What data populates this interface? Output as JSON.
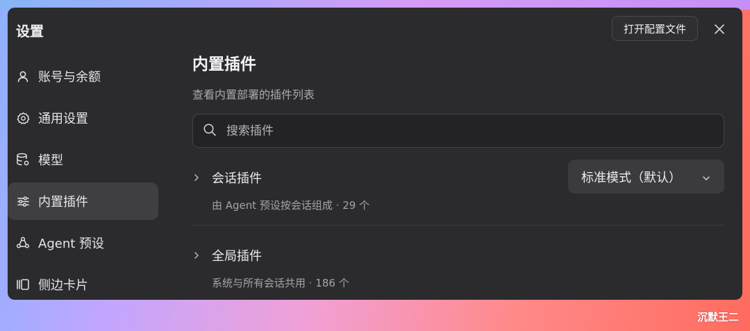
{
  "window": {
    "title": "设置",
    "open_config_label": "打开配置文件"
  },
  "sidebar": {
    "items": [
      {
        "label": "账号与余额",
        "icon": "user-icon"
      },
      {
        "label": "通用设置",
        "icon": "gear-icon"
      },
      {
        "label": "模型",
        "icon": "database-icon"
      },
      {
        "label": "内置插件",
        "icon": "sliders-icon",
        "active": true
      },
      {
        "label": "Agent 预设",
        "icon": "agent-icon"
      },
      {
        "label": "侧边卡片",
        "icon": "side-card-icon"
      }
    ]
  },
  "main": {
    "title": "内置插件",
    "subtitle": "查看内置部署的插件列表",
    "search": {
      "placeholder": "搜索插件"
    },
    "groups": [
      {
        "name": "会话插件",
        "desc": "由 Agent 预设按会话组成 · 29 个",
        "mode": "标准模式（默认）"
      },
      {
        "name": "全局插件",
        "desc": "系统与所有会话共用 · 186 个"
      }
    ]
  },
  "watermark": "沉默王二"
}
